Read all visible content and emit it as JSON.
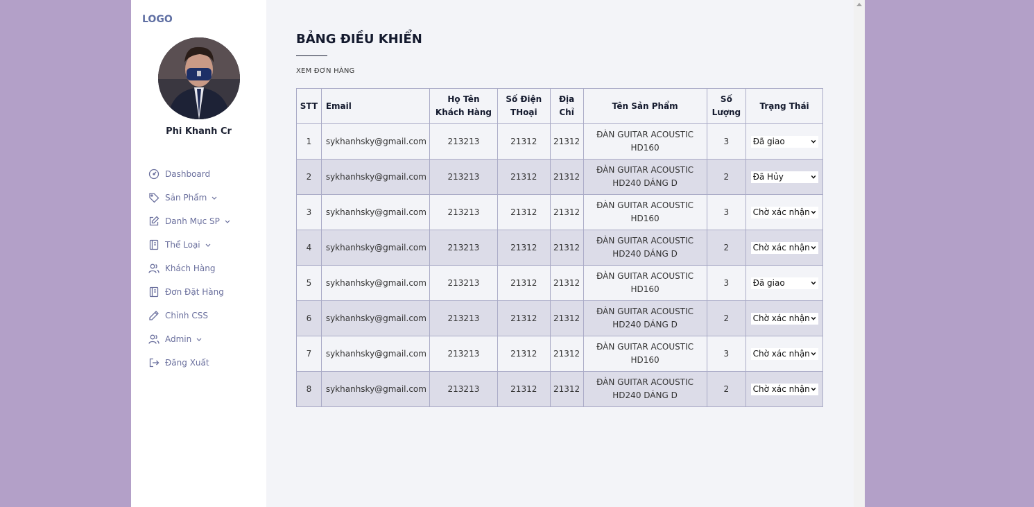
{
  "sidebar": {
    "logo": "LOGO",
    "profile_name": "Phi Khanh Cr",
    "items": [
      {
        "label": "Dashboard",
        "icon": "dashboard-icon",
        "has_chevron": false
      },
      {
        "label": "Sản Phẩm",
        "icon": "tag-icon",
        "has_chevron": true
      },
      {
        "label": "Danh Mục SP",
        "icon": "edit-icon",
        "has_chevron": true
      },
      {
        "label": "Thể Loại",
        "icon": "book-icon",
        "has_chevron": true
      },
      {
        "label": "Khách Hàng",
        "icon": "users-icon",
        "has_chevron": false
      },
      {
        "label": "Đơn Đặt Hàng",
        "icon": "book-icon",
        "has_chevron": false
      },
      {
        "label": "Chỉnh CSS",
        "icon": "pencil-icon",
        "has_chevron": false
      },
      {
        "label": "Admin",
        "icon": "users-icon",
        "has_chevron": true
      },
      {
        "label": "Đăng Xuất",
        "icon": "logout-icon",
        "has_chevron": false
      }
    ]
  },
  "main": {
    "title": "BẢNG ĐIỀU KHIỂN",
    "subtitle": "XEM ĐƠN HÀNG",
    "table": {
      "headers": [
        "STT",
        "Email",
        "Họ Tên Khách Hàng",
        "Số Điện THoại",
        "Địa Chỉ",
        "Tên Sản Phẩm",
        "Số Lượng",
        "Trạng Thái"
      ],
      "rows": [
        {
          "stt": "1",
          "email": "sykhanhsky@gmail.com",
          "name": "213213",
          "phone": "21312",
          "address": "21312",
          "product": "ĐÀN GUITAR ACOUSTIC HD160",
          "qty": "3",
          "status": "Đã giao"
        },
        {
          "stt": "2",
          "email": "sykhanhsky@gmail.com",
          "name": "213213",
          "phone": "21312",
          "address": "21312",
          "product": "ĐÀN GUITAR ACOUSTIC HD240 DÁNG D",
          "qty": "2",
          "status": "Đã Hủy"
        },
        {
          "stt": "3",
          "email": "sykhanhsky@gmail.com",
          "name": "213213",
          "phone": "21312",
          "address": "21312",
          "product": "ĐÀN GUITAR ACOUSTIC HD160",
          "qty": "3",
          "status": "Chờ xác nhận"
        },
        {
          "stt": "4",
          "email": "sykhanhsky@gmail.com",
          "name": "213213",
          "phone": "21312",
          "address": "21312",
          "product": "ĐÀN GUITAR ACOUSTIC HD240 DÁNG D",
          "qty": "2",
          "status": "Chờ xác nhận"
        },
        {
          "stt": "5",
          "email": "sykhanhsky@gmail.com",
          "name": "213213",
          "phone": "21312",
          "address": "21312",
          "product": "ĐÀN GUITAR ACOUSTIC HD160",
          "qty": "3",
          "status": "Đã giao"
        },
        {
          "stt": "6",
          "email": "sykhanhsky@gmail.com",
          "name": "213213",
          "phone": "21312",
          "address": "21312",
          "product": "ĐÀN GUITAR ACOUSTIC HD240 DÁNG D",
          "qty": "2",
          "status": "Chờ xác nhận"
        },
        {
          "stt": "7",
          "email": "sykhanhsky@gmail.com",
          "name": "213213",
          "phone": "21312",
          "address": "21312",
          "product": "ĐÀN GUITAR ACOUSTIC HD160",
          "qty": "3",
          "status": "Chờ xác nhận"
        },
        {
          "stt": "8",
          "email": "sykhanhsky@gmail.com",
          "name": "213213",
          "phone": "21312",
          "address": "21312",
          "product": "ĐÀN GUITAR ACOUSTIC HD240 DÁNG D",
          "qty": "2",
          "status": "Chờ xác nhận"
        }
      ]
    }
  },
  "colors": {
    "page_background": "#b3a0c8",
    "main_background": "#f3f4f8",
    "sidebar_text": "#6a6f9d",
    "logo": "#5f6fa3",
    "row_alt": "#dcdce8",
    "table_border": "#a9aac6"
  }
}
